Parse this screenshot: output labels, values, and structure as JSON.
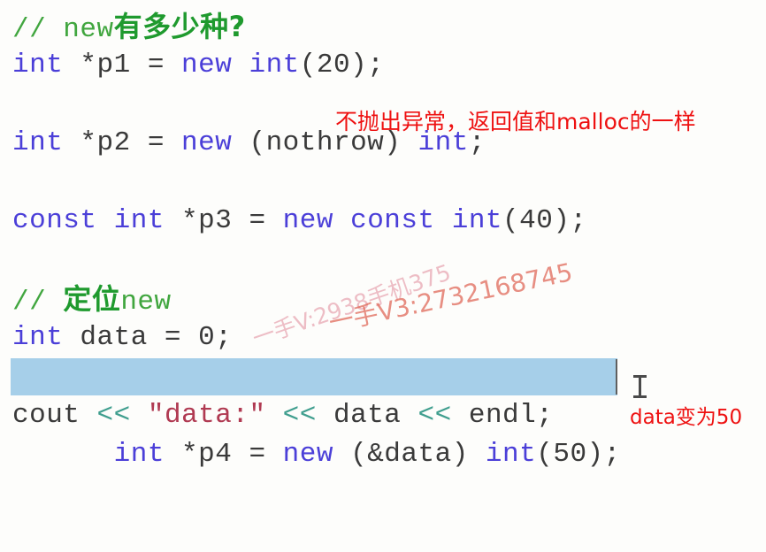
{
  "editor": {
    "background_color": "#fdfdfb",
    "selection_color": "#a6cfe9",
    "colors": {
      "keyword": "#4b3fd8",
      "plain": "#3a3a3a",
      "comment": "#41a63f",
      "comment_cjk": "#1f9a2e",
      "string": "#b03a52",
      "stream_operator": "#3f9e8e",
      "annotation_red": "#ee1111"
    }
  },
  "code": {
    "line1": {
      "comment_ascii": "// new",
      "comment_cjk": "有多少种?"
    },
    "line2": {
      "kw_int": "int",
      "mid": " *p1 = ",
      "kw_new": "new",
      "sp": " ",
      "kw_int2": "int",
      "tail": "(20);"
    },
    "line3_blank": "",
    "line4": {
      "kw_int": "int",
      "mid": " *p2 = ",
      "kw_new": "new",
      "paren": " (nothrow) ",
      "kw_int2": "int",
      "tail": ";"
    },
    "line5_blank": "",
    "line6": {
      "kw_const": "const",
      "sp1": " ",
      "kw_int": "int",
      "mid": " *p3 = ",
      "kw_new": "new",
      "sp2": " ",
      "kw_const2": "const",
      "sp3": " ",
      "kw_int2": "int",
      "tail": "(40);"
    },
    "line7_blank": "",
    "line8": {
      "comment_ascii": "// ",
      "comment_cjk": "定位",
      "comment_ascii2": "new"
    },
    "line9": {
      "kw_int": "int",
      "rest": " data = 0;"
    },
    "line10_selected": {
      "kw_int": "int",
      "mid": " *p4 = ",
      "kw_new": "new",
      "paren": " (&data) ",
      "kw_int2": "int",
      "tail": "(50);",
      "is_selected": true
    },
    "line11": {
      "cout": "cout",
      "op1": " << ",
      "str": "\"data:\"",
      "op2": " << ",
      "var": "data",
      "op3": " << ",
      "endl": "endl;"
    }
  },
  "annotations": {
    "nothrow_note": "不抛出异常，返回值和malloc的一样",
    "data_note": "data变为50"
  },
  "watermarks": {
    "line_a": "一手V:2938手机375",
    "line_b": "一手V3:2732168745"
  },
  "cursor": {
    "type": "i-beam-text-cursor"
  }
}
